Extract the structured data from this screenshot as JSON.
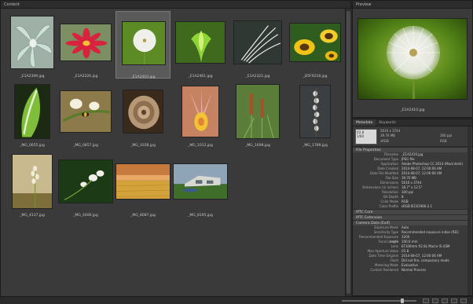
{
  "panels": {
    "content_title": "Content",
    "preview_title": "Preview"
  },
  "thumbnails": [
    {
      "label": "_E1A2399.jpg",
      "kind": "succulent"
    },
    {
      "label": "_E1A2226.jpg",
      "kind": "red-flower"
    },
    {
      "label": "_E1A2410.jpg",
      "kind": "dandelion",
      "selected": true
    },
    {
      "label": "_E1A2461.jpg",
      "kind": "bud"
    },
    {
      "label": "_E1A2322.jpg",
      "kind": "white-grass"
    },
    {
      "label": "_D5F0218.jpg",
      "kind": "sunflowers"
    },
    {
      "label": "_MG_0655.jpg",
      "kind": "leaf"
    },
    {
      "label": "_MG_0857.jpg",
      "kind": "bee"
    },
    {
      "label": "_MG_1038.jpg",
      "kind": "rose"
    },
    {
      "label": "_MG_1012.jpg",
      "kind": "pink-flower"
    },
    {
      "label": "_MG_1698.jpg",
      "kind": "cattails"
    },
    {
      "label": "_MG_1789.jpg",
      "kind": "seedstalk"
    },
    {
      "label": "_MG_4137.jpg",
      "kind": "wildflower"
    },
    {
      "label": "_MG_4406.jpg",
      "kind": "white-flowers"
    },
    {
      "label": "_MG_8087.jpg",
      "kind": "wheat-field"
    },
    {
      "label": "_MG_8195.jpg",
      "kind": "house"
    }
  ],
  "preview": {
    "label": "_E1A2410.jpg"
  },
  "metadata": {
    "tabs": [
      "Metadata",
      "Keywords"
    ],
    "summary_box": {
      "line1": "f/2.8",
      "line2": "1/60"
    },
    "summary_grid": [
      "5616 x 3744",
      "",
      "",
      "39.70 MB",
      "",
      "300 ppi",
      "sRGB",
      "",
      "RGB"
    ],
    "sections": [
      {
        "title": "File Properties",
        "rows": [
          {
            "k": "Filename",
            "v": "_E1A2410.jpg"
          },
          {
            "k": "Document Type",
            "v": "JPEG file"
          },
          {
            "k": "Application",
            "v": "Adobe Photoshop CC 2014 (Macintosh)"
          },
          {
            "k": "Date Created",
            "v": "2014-08-07, 12:00:06 AM"
          },
          {
            "k": "Date File Modified",
            "v": "2014-08-07, 12:00:06 AM"
          },
          {
            "k": "File Size",
            "v": "39.70 MB"
          },
          {
            "k": "Dimensions",
            "v": "5616 x 3744"
          },
          {
            "k": "Dimensions (in inches)",
            "v": "18.7\" x 12.5\""
          },
          {
            "k": "Resolution",
            "v": "300 ppi"
          },
          {
            "k": "Bit Depth",
            "v": "8"
          },
          {
            "k": "Color Mode",
            "v": "RGB"
          },
          {
            "k": "Color Profile",
            "v": "sRGB IEC61966-2.1"
          }
        ]
      },
      {
        "title": "IPTC Core",
        "rows": []
      },
      {
        "title": "IPTC Extension",
        "rows": []
      },
      {
        "title": "Camera Data (Exif)",
        "rows": [
          {
            "k": "Exposure Mode",
            "v": "Auto"
          },
          {
            "k": "Sensitivity Type",
            "v": "Recommended exposure index (REI)"
          },
          {
            "k": "Recommended Exposure Index",
            "v": "3200"
          },
          {
            "k": "Focal Length",
            "v": "100.0 mm"
          },
          {
            "k": "Lens",
            "v": "EF100mm f/2.8L Macro IS USM"
          },
          {
            "k": "Max Aperture Value",
            "v": "f/2.8"
          },
          {
            "k": "Date Time Original",
            "v": "2014-08-07, 12:00:06 AM"
          },
          {
            "k": "Flash",
            "v": "Did not fire, compulsory mode"
          },
          {
            "k": "Metering Mode",
            "v": "Evaluative"
          },
          {
            "k": "Custom Rendered",
            "v": "Normal Process"
          }
        ]
      }
    ]
  }
}
